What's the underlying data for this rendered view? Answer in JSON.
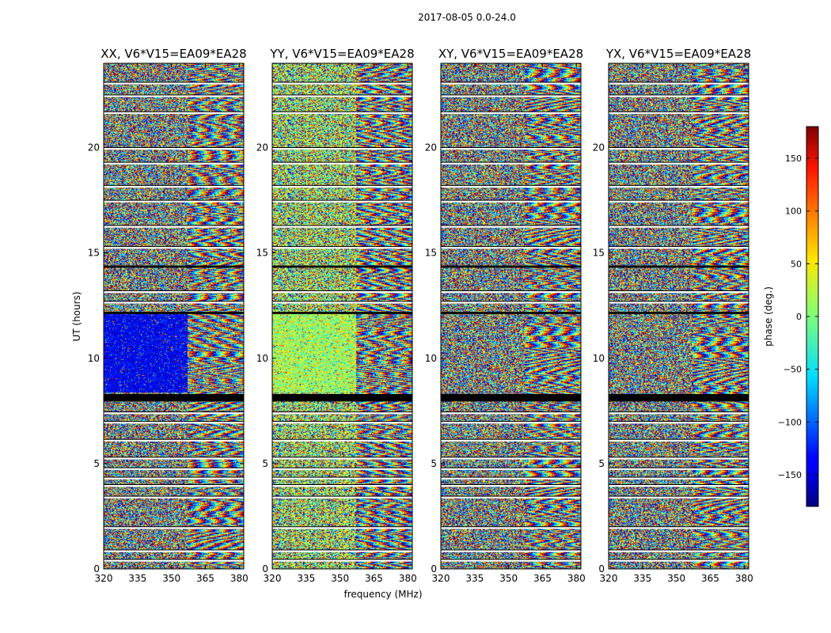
{
  "chart_data": {
    "type": "heatmap",
    "title": "2017-08-05 0.0-24.0",
    "xlabel": "frequency (MHz)",
    "ylabel": "UT (hours)",
    "xlim": [
      320,
      382
    ],
    "ylim": [
      0,
      24
    ],
    "x_ticks": [
      320,
      335,
      350,
      365,
      380
    ],
    "y_ticks": [
      0,
      5,
      10,
      15,
      20
    ],
    "colormap": "jet",
    "colorbar": {
      "label": "phase (deg.)",
      "range": [
        -180,
        180
      ],
      "ticks": [
        -150,
        -100,
        -50,
        0,
        50,
        100,
        150
      ],
      "tick_labels": [
        "−150",
        "−100",
        "−50",
        "0",
        "50",
        "100",
        "150"
      ]
    },
    "panels": [
      {
        "title": "XX, V6*V15=EA09*EA28"
      },
      {
        "title": "YY, V6*V15=EA09*EA28"
      },
      {
        "title": "XY, V6*V15=EA09*EA28"
      },
      {
        "title": "YX, V6*V15=EA09*EA28"
      }
    ],
    "flagged_gaps_hours": [
      [
        0.35,
        0.45
      ],
      [
        0.8,
        0.9
      ],
      [
        1.9,
        2.0
      ],
      [
        3.35,
        3.45
      ],
      [
        3.9,
        4.0
      ],
      [
        4.25,
        4.35
      ],
      [
        4.7,
        4.8
      ],
      [
        5.2,
        5.3
      ],
      [
        6.05,
        6.15
      ],
      [
        6.9,
        7.0
      ],
      [
        7.35,
        7.45
      ],
      [
        12.6,
        12.7
      ],
      [
        13.1,
        13.2
      ],
      [
        15.2,
        15.3
      ],
      [
        16.2,
        16.3
      ],
      [
        17.4,
        17.5
      ],
      [
        18.1,
        18.2
      ],
      [
        19.2,
        19.3
      ],
      [
        19.9,
        20.0
      ],
      [
        21.6,
        21.7
      ],
      [
        22.4,
        22.5
      ],
      [
        23.0,
        23.1
      ]
    ],
    "black_bands_hours": [
      [
        7.95,
        8.3
      ],
      [
        14.3,
        14.4
      ],
      [
        12.1,
        12.2
      ]
    ]
  }
}
